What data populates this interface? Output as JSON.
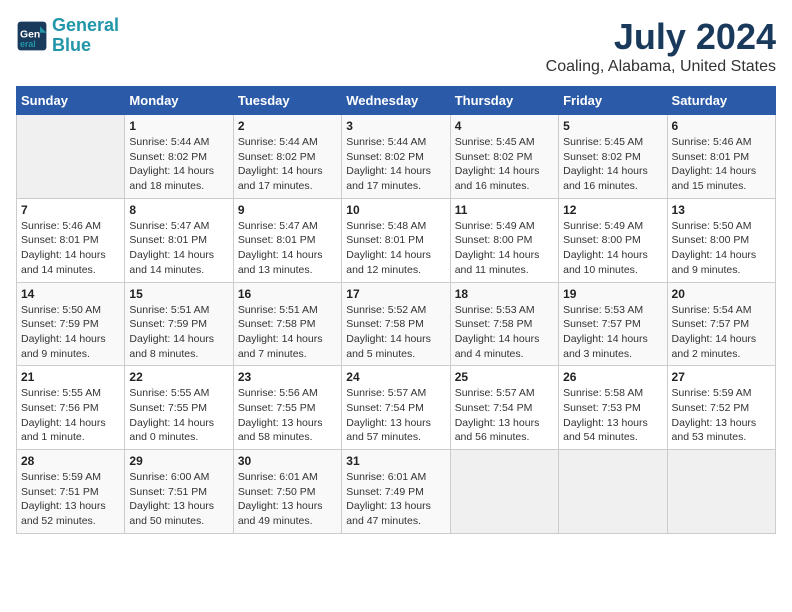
{
  "header": {
    "logo_line1": "General",
    "logo_line2": "Blue",
    "title": "July 2024",
    "subtitle": "Coaling, Alabama, United States"
  },
  "days_of_week": [
    "Sunday",
    "Monday",
    "Tuesday",
    "Wednesday",
    "Thursday",
    "Friday",
    "Saturday"
  ],
  "weeks": [
    [
      {
        "day": "",
        "info": ""
      },
      {
        "day": "1",
        "info": "Sunrise: 5:44 AM\nSunset: 8:02 PM\nDaylight: 14 hours\nand 18 minutes."
      },
      {
        "day": "2",
        "info": "Sunrise: 5:44 AM\nSunset: 8:02 PM\nDaylight: 14 hours\nand 17 minutes."
      },
      {
        "day": "3",
        "info": "Sunrise: 5:44 AM\nSunset: 8:02 PM\nDaylight: 14 hours\nand 17 minutes."
      },
      {
        "day": "4",
        "info": "Sunrise: 5:45 AM\nSunset: 8:02 PM\nDaylight: 14 hours\nand 16 minutes."
      },
      {
        "day": "5",
        "info": "Sunrise: 5:45 AM\nSunset: 8:02 PM\nDaylight: 14 hours\nand 16 minutes."
      },
      {
        "day": "6",
        "info": "Sunrise: 5:46 AM\nSunset: 8:01 PM\nDaylight: 14 hours\nand 15 minutes."
      }
    ],
    [
      {
        "day": "7",
        "info": "Sunrise: 5:46 AM\nSunset: 8:01 PM\nDaylight: 14 hours\nand 14 minutes."
      },
      {
        "day": "8",
        "info": "Sunrise: 5:47 AM\nSunset: 8:01 PM\nDaylight: 14 hours\nand 14 minutes."
      },
      {
        "day": "9",
        "info": "Sunrise: 5:47 AM\nSunset: 8:01 PM\nDaylight: 14 hours\nand 13 minutes."
      },
      {
        "day": "10",
        "info": "Sunrise: 5:48 AM\nSunset: 8:01 PM\nDaylight: 14 hours\nand 12 minutes."
      },
      {
        "day": "11",
        "info": "Sunrise: 5:49 AM\nSunset: 8:00 PM\nDaylight: 14 hours\nand 11 minutes."
      },
      {
        "day": "12",
        "info": "Sunrise: 5:49 AM\nSunset: 8:00 PM\nDaylight: 14 hours\nand 10 minutes."
      },
      {
        "day": "13",
        "info": "Sunrise: 5:50 AM\nSunset: 8:00 PM\nDaylight: 14 hours\nand 9 minutes."
      }
    ],
    [
      {
        "day": "14",
        "info": "Sunrise: 5:50 AM\nSunset: 7:59 PM\nDaylight: 14 hours\nand 9 minutes."
      },
      {
        "day": "15",
        "info": "Sunrise: 5:51 AM\nSunset: 7:59 PM\nDaylight: 14 hours\nand 8 minutes."
      },
      {
        "day": "16",
        "info": "Sunrise: 5:51 AM\nSunset: 7:58 PM\nDaylight: 14 hours\nand 7 minutes."
      },
      {
        "day": "17",
        "info": "Sunrise: 5:52 AM\nSunset: 7:58 PM\nDaylight: 14 hours\nand 5 minutes."
      },
      {
        "day": "18",
        "info": "Sunrise: 5:53 AM\nSunset: 7:58 PM\nDaylight: 14 hours\nand 4 minutes."
      },
      {
        "day": "19",
        "info": "Sunrise: 5:53 AM\nSunset: 7:57 PM\nDaylight: 14 hours\nand 3 minutes."
      },
      {
        "day": "20",
        "info": "Sunrise: 5:54 AM\nSunset: 7:57 PM\nDaylight: 14 hours\nand 2 minutes."
      }
    ],
    [
      {
        "day": "21",
        "info": "Sunrise: 5:55 AM\nSunset: 7:56 PM\nDaylight: 14 hours\nand 1 minute."
      },
      {
        "day": "22",
        "info": "Sunrise: 5:55 AM\nSunset: 7:55 PM\nDaylight: 14 hours\nand 0 minutes."
      },
      {
        "day": "23",
        "info": "Sunrise: 5:56 AM\nSunset: 7:55 PM\nDaylight: 13 hours\nand 58 minutes."
      },
      {
        "day": "24",
        "info": "Sunrise: 5:57 AM\nSunset: 7:54 PM\nDaylight: 13 hours\nand 57 minutes."
      },
      {
        "day": "25",
        "info": "Sunrise: 5:57 AM\nSunset: 7:54 PM\nDaylight: 13 hours\nand 56 minutes."
      },
      {
        "day": "26",
        "info": "Sunrise: 5:58 AM\nSunset: 7:53 PM\nDaylight: 13 hours\nand 54 minutes."
      },
      {
        "day": "27",
        "info": "Sunrise: 5:59 AM\nSunset: 7:52 PM\nDaylight: 13 hours\nand 53 minutes."
      }
    ],
    [
      {
        "day": "28",
        "info": "Sunrise: 5:59 AM\nSunset: 7:51 PM\nDaylight: 13 hours\nand 52 minutes."
      },
      {
        "day": "29",
        "info": "Sunrise: 6:00 AM\nSunset: 7:51 PM\nDaylight: 13 hours\nand 50 minutes."
      },
      {
        "day": "30",
        "info": "Sunrise: 6:01 AM\nSunset: 7:50 PM\nDaylight: 13 hours\nand 49 minutes."
      },
      {
        "day": "31",
        "info": "Sunrise: 6:01 AM\nSunset: 7:49 PM\nDaylight: 13 hours\nand 47 minutes."
      },
      {
        "day": "",
        "info": ""
      },
      {
        "day": "",
        "info": ""
      },
      {
        "day": "",
        "info": ""
      }
    ]
  ]
}
